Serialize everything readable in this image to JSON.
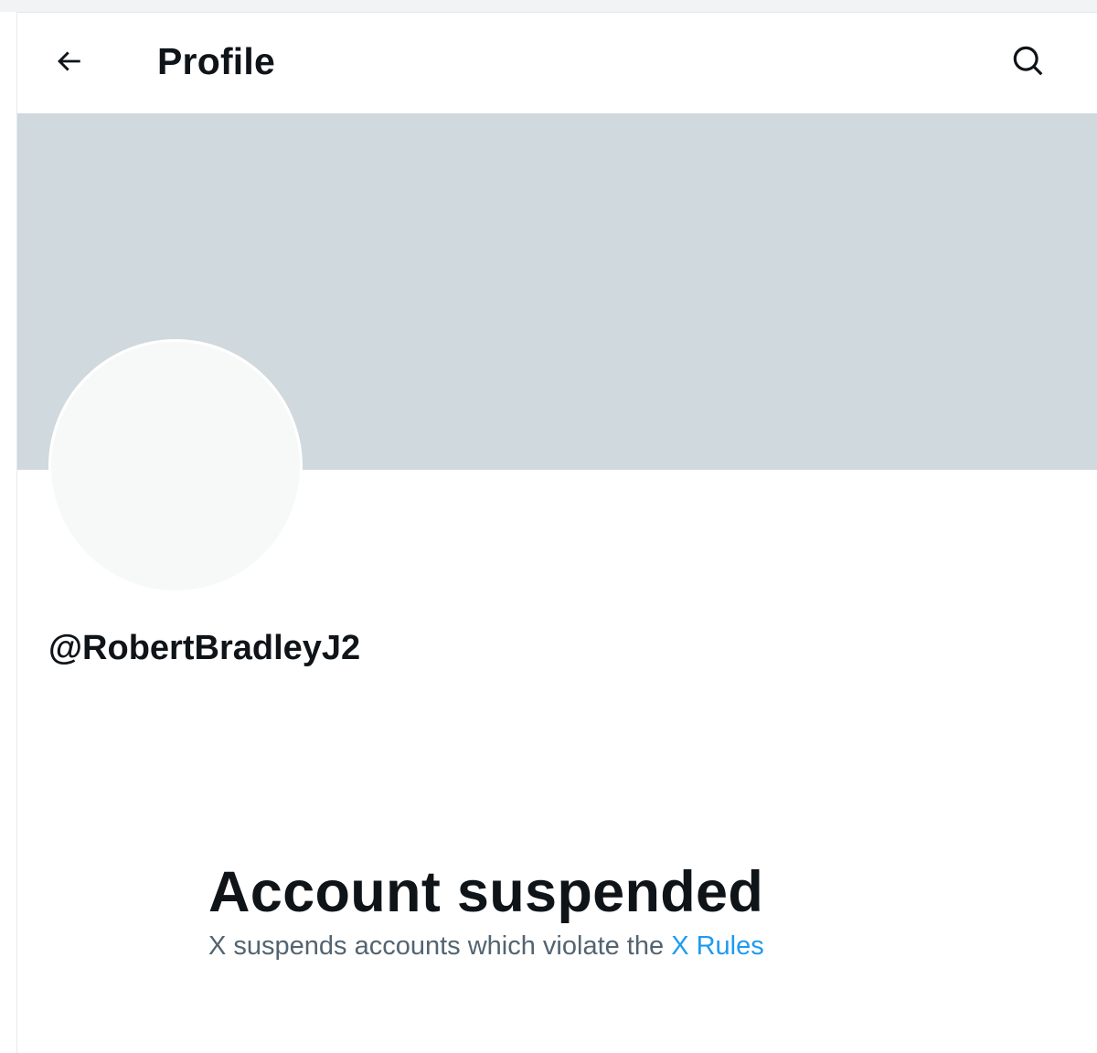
{
  "header": {
    "title": "Profile",
    "back_icon": "arrow-left-icon",
    "search_icon": "search-icon"
  },
  "profile": {
    "handle": "@RobertBradleyJ2",
    "banner_color": "#cfd9de",
    "avatar_color": "#f7f9f9"
  },
  "status": {
    "title": "Account suspended",
    "message": "X suspends accounts which violate the",
    "link_text": "X Rules",
    "link_color": "#1d9bf0"
  }
}
